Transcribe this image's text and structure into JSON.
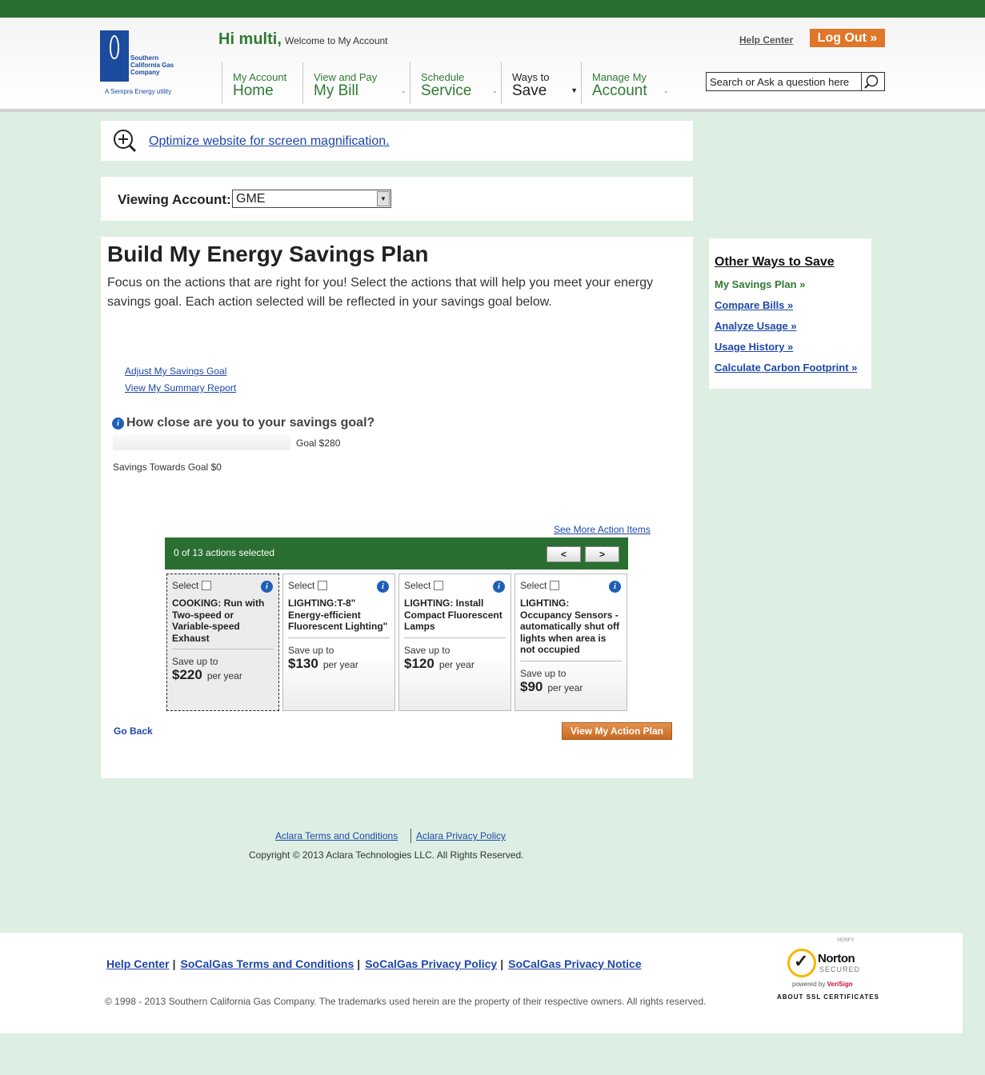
{
  "header": {
    "logo": {
      "company": "Southern California Gas Company",
      "sempra": "A Sempra Energy utility"
    },
    "greeting": "Hi multi,",
    "welcome": "Welcome to My Account",
    "help_center": "Help Center",
    "logout": "Log Out »",
    "nav": [
      {
        "small": "My Account",
        "big": "Home"
      },
      {
        "small": "View and Pay",
        "big": "My Bill"
      },
      {
        "small": "Schedule",
        "big": "Service"
      },
      {
        "small": "Ways to",
        "big": "Save"
      },
      {
        "small": "Manage My",
        "big": "Account"
      }
    ],
    "search_placeholder": "Search or Ask a question here"
  },
  "magnify": {
    "link": "Optimize website for screen magnification."
  },
  "viewing": {
    "label": "Viewing Account:",
    "selected": "GME"
  },
  "main": {
    "title": "Build My Energy Savings Plan",
    "intro": "Focus on the actions that are right for you! Select the actions that will help you meet your energy savings goal. Each action selected will be reflected in your savings goal below.",
    "adjust_link": "Adjust My Savings Goal",
    "summary_link": "View My Summary Report",
    "goal_question": "How close are you to your savings goal?",
    "goal_label": "Goal $280",
    "savings_towards": "Savings Towards Goal $0",
    "see_more": "See More Action Items",
    "actions_count": "0 of 13 actions selected",
    "prev": "<",
    "next": ">",
    "cards": [
      {
        "select": "Select",
        "title": "COOKING: Run with Two-speed or Variable-speed Exhaust",
        "save_label": "Save up to",
        "amount": "$220",
        "per": "per year"
      },
      {
        "select": "Select",
        "title": "LIGHTING:T-8\" Energy-efficient Fluorescent Lighting\"",
        "save_label": "Save up to",
        "amount": "$130",
        "per": "per year"
      },
      {
        "select": "Select",
        "title": "LIGHTING: Install Compact Fluorescent Lamps",
        "save_label": "Save up to",
        "amount": "$120",
        "per": "per year"
      },
      {
        "select": "Select",
        "title": "LIGHTING: Occupancy Sensors - automatically shut off lights when area is not occupied",
        "save_label": "Save up to",
        "amount": "$90",
        "per": "per year"
      }
    ],
    "go_back": "Go Back",
    "view_plan": "View My Action Plan"
  },
  "sidebar": {
    "title": "Other Ways to Save",
    "links": [
      "My Savings Plan »",
      "Compare Bills »",
      "Analyze Usage »",
      "Usage History »",
      "Calculate Carbon Footprint »"
    ]
  },
  "aclara": {
    "terms": "Aclara Terms and Conditions",
    "privacy": "Aclara Privacy Policy",
    "copyright": "Copyright © 2013 Aclara Technologies LLC. All Rights Reserved."
  },
  "footer": {
    "links": [
      "Help Center",
      "SoCalGas Terms and Conditions",
      "SoCalGas Privacy Policy",
      "SoCalGas Privacy Notice"
    ],
    "copyright": "© 1998 - 2013 Southern California Gas Company. The trademarks used herein are the property of their respective owners. All rights reserved.",
    "norton": {
      "verify": "VERIFY",
      "brand": "Norton",
      "secured": "SECURED",
      "powered": "powered by",
      "verisign": "VeriSign",
      "about": "ABOUT SSL CERTIFICATES"
    }
  }
}
